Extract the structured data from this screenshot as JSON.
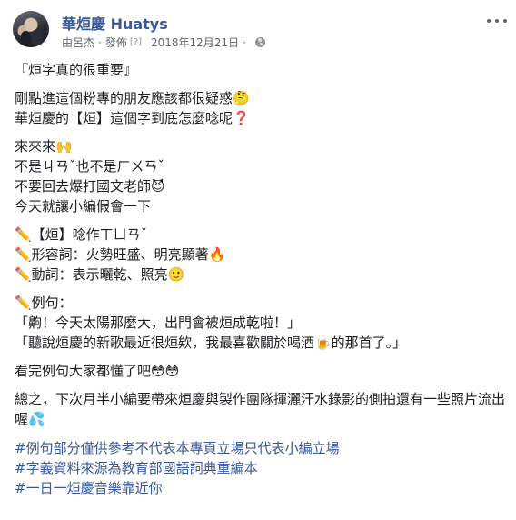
{
  "post": {
    "page_name": "華烜慶 Huatys",
    "author_prefix": "由呂杰",
    "published": "發佈",
    "bracket_mark": "[?]",
    "date": "2018年12月21日",
    "privacy_icon": "globe-icon",
    "more_icon": "ellipsis-icon"
  },
  "content": {
    "paragraphs": [
      [
        "『烜字真的很重要』"
      ],
      [
        "剛點進這個粉專的朋友應該都很疑惑🤔",
        "華烜慶的【烜】這個字到底怎麼唸呢❓"
      ],
      [
        "來來來🙌",
        "不是ㄐㄢˇ也不是ㄏㄨㄢˇ",
        "不要回去爆打國文老師😈",
        "今天就讓小編假會一下"
      ],
      [
        "✏️【烜】唸作ㄒㄩㄢˇ",
        "✏️形容詞：火勢旺盛、明亮顯著🔥",
        "✏️動詞：表示曬乾、照亮🙂"
      ],
      [
        "✏️例句：",
        "「齁！今天太陽那麼大，出門會被烜成乾啦！」",
        "「聽說烜慶的新歌最近很烜欸，我最喜歡關於喝酒🍺的那首了。」"
      ],
      [
        "看完例句大家都懂了吧😳😳"
      ],
      [
        "總之，下次月半小編要帶來烜慶與製作團隊揮灑汗水錄影的側拍還有一些照片流出喔💦"
      ]
    ],
    "hashtags": [
      "#例句部分僅供參考不代表本專頁立場只代表小編立場",
      "#字義資料來源為教育部國語詞典重編本",
      "#一日一烜慶音樂靠近你"
    ]
  }
}
